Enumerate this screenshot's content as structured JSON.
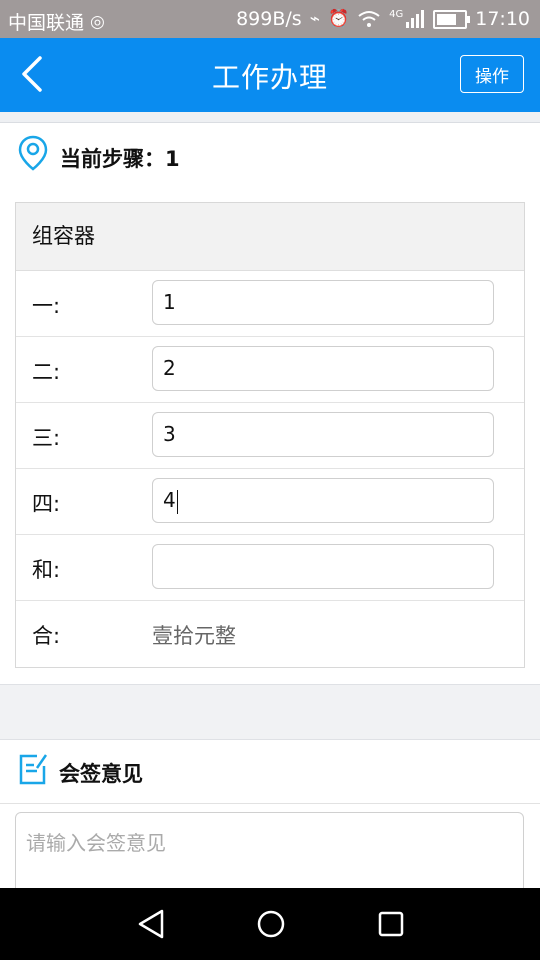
{
  "status_bar": {
    "carrier": "中国联通",
    "net_speed": "899B/s",
    "network_type": "4G",
    "time": "17:10",
    "battery_level": 0.72
  },
  "app_bar": {
    "title": "工作办理",
    "action_label": "操作",
    "accent_color": "#0a8cf0"
  },
  "step": {
    "label": "当前步骤：1"
  },
  "form": {
    "group_title": "组容器",
    "rows": [
      {
        "label": "一:",
        "value": "1"
      },
      {
        "label": "二:",
        "value": "2"
      },
      {
        "label": "三:",
        "value": "3"
      },
      {
        "label": "四:",
        "value": "4"
      },
      {
        "label": "和:",
        "value": ""
      }
    ],
    "total": {
      "label": "合:",
      "value": "壹拾元整"
    }
  },
  "countersign": {
    "title": "会签意见",
    "placeholder": "请输入会签意见"
  }
}
